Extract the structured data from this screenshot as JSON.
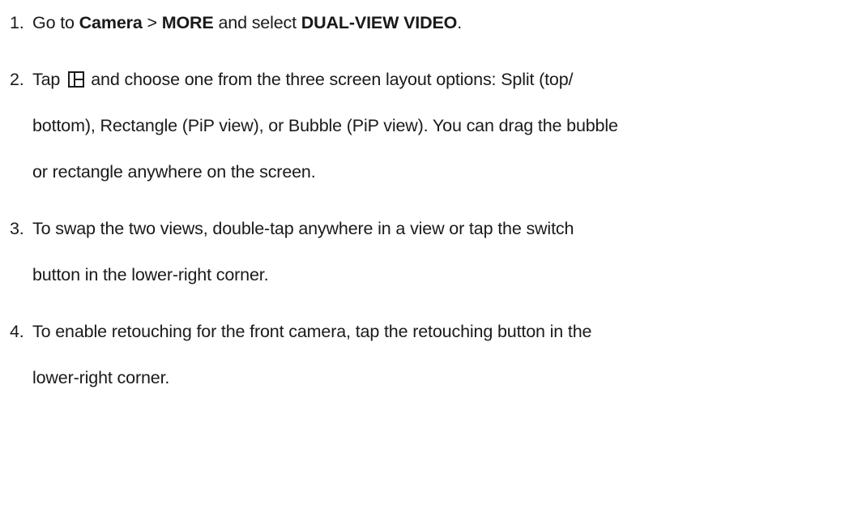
{
  "steps": [
    {
      "number": "1.",
      "text": {
        "a": "Go to ",
        "b": "Camera",
        "c": " > ",
        "d": "MORE",
        "e": " and select ",
        "f": "DUAL-VIEW VIDEO",
        "g": "."
      }
    },
    {
      "number": "2.",
      "icon": "layout-toggle-icon",
      "text": {
        "pre": "Tap",
        "post": "and choose one from the three screen layout options: Split (top/",
        "line2": "bottom), Rectangle (PiP view), or Bubble (PiP view). You can drag the bubble",
        "line3": "or rectangle anywhere on the screen."
      }
    },
    {
      "number": "3.",
      "text": {
        "line1": "To swap the two views, double-tap anywhere in a view or tap the switch",
        "line2": "button in the lower-right corner."
      }
    },
    {
      "number": "4.",
      "text": {
        "line1": "To enable retouching for the front camera, tap the retouching button in the",
        "line2": "lower-right corner."
      }
    }
  ]
}
